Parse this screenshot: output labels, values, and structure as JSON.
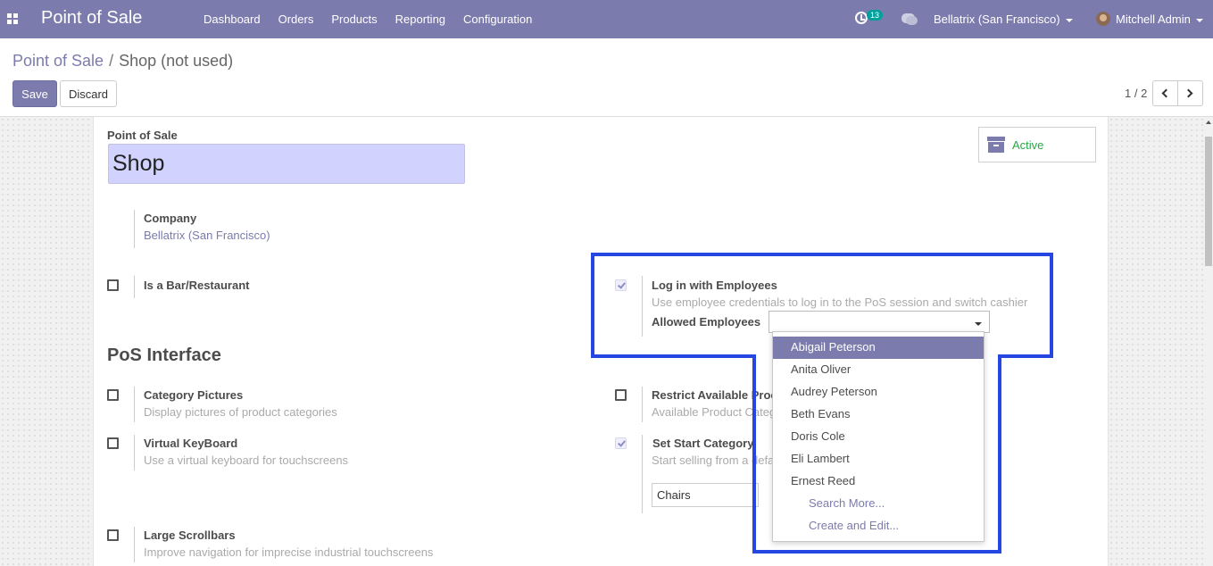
{
  "navbar": {
    "app_title": "Point of Sale",
    "menu": [
      "Dashboard",
      "Orders",
      "Products",
      "Reporting",
      "Configuration"
    ],
    "activity_count": "13",
    "company": "Bellatrix (San Francisco)",
    "user": "Mitchell Admin"
  },
  "breadcrumb": {
    "parent": "Point of Sale",
    "separator": "/",
    "current": "Shop (not used)"
  },
  "buttons": {
    "save": "Save",
    "discard": "Discard"
  },
  "pager": {
    "value": "1 / 2"
  },
  "form": {
    "name_label": "Point of Sale",
    "name_value": "Shop",
    "active_label": "Active",
    "company_label": "Company",
    "company_value": "Bellatrix (San Francisco)",
    "bar_restaurant": "Is a Bar/Restaurant",
    "login_employees": {
      "title": "Log in with Employees",
      "desc": "Use employee credentials to log in to the PoS session and switch cashier",
      "allowed_label": "Allowed Employees"
    },
    "pos_interface_title": "PoS Interface",
    "category_pictures": {
      "title": "Category Pictures",
      "desc": "Display pictures of product categories"
    },
    "restrict_categories": {
      "title": "Restrict Available Proc",
      "desc": "Available Product Categ"
    },
    "virtual_keyboard": {
      "title": "Virtual KeyBoard",
      "desc": "Use a virtual keyboard for touchscreens"
    },
    "start_category": {
      "title": "Set Start Category",
      "desc": "Start selling from a defa",
      "value": "Chairs"
    },
    "large_scrollbars": {
      "title": "Large Scrollbars",
      "desc": "Improve navigation for imprecise industrial touchscreens"
    }
  },
  "dropdown": {
    "items": [
      "Abigail Peterson",
      "Anita Oliver",
      "Audrey Peterson",
      "Beth Evans",
      "Doris Cole",
      "Eli Lambert",
      "Ernest Reed"
    ],
    "selected_index": 0,
    "search_more": "Search More...",
    "create_edit": "Create and Edit..."
  },
  "colors": {
    "brand": "#7c7bad",
    "highlight_outline": "#2546e0",
    "active": "#28a745"
  }
}
